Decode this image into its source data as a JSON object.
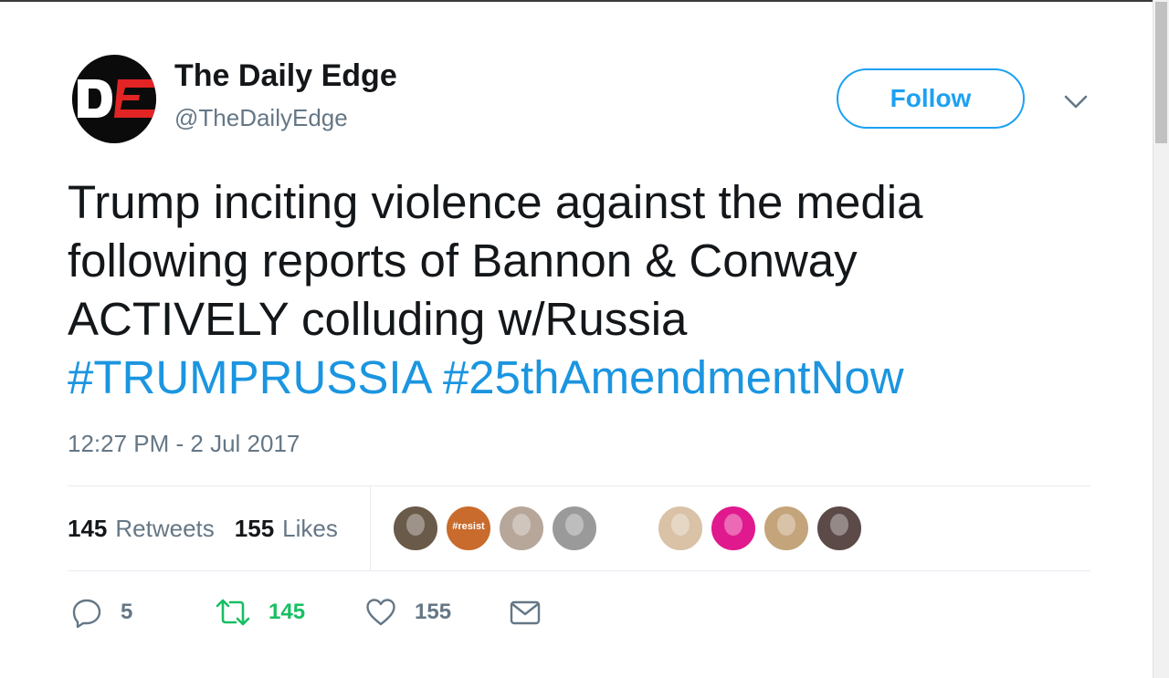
{
  "user": {
    "display_name": "The Daily Edge",
    "handle": "@TheDailyEdge",
    "avatar_icon": "the-daily-edge-logo"
  },
  "follow_button": {
    "label": "Follow"
  },
  "menu_icon": "chevron-down-icon",
  "tweet": {
    "lines": [
      "Trump inciting violence against the media",
      "following reports of Bannon & Conway",
      "ACTIVELY colluding w/Russia"
    ],
    "hashtags": [
      "#TRUMPRUSSIA",
      "#25thAmendmentNow"
    ],
    "timestamp": "12:27 PM - 2 Jul 2017"
  },
  "stats": {
    "retweets_count": "145",
    "retweets_label": "Retweets",
    "likes_count": "155",
    "likes_label": "Likes"
  },
  "likers": [
    {
      "name": "liker-avatar-1",
      "color": "#6a5a4a",
      "label": ""
    },
    {
      "name": "liker-avatar-2",
      "color": "#c86b2c",
      "label": "#resist"
    },
    {
      "name": "liker-avatar-3",
      "color": "#b6a79a",
      "label": ""
    },
    {
      "name": "liker-avatar-4",
      "color": "#9a9a9a",
      "label": ""
    },
    {
      "name": "liker-avatar-5",
      "color": "#ffffff",
      "label": ""
    },
    {
      "name": "liker-avatar-6",
      "color": "#d9c2a6",
      "label": ""
    },
    {
      "name": "liker-avatar-7",
      "color": "#e0198e",
      "label": ""
    },
    {
      "name": "liker-avatar-8",
      "color": "#c4a47a",
      "label": ""
    },
    {
      "name": "liker-avatar-9",
      "color": "#5b4a48",
      "label": ""
    }
  ],
  "actions": {
    "reply_count": "5",
    "retweet_count": "145",
    "like_count": "155",
    "retweet_color": "#17bf63",
    "muted_color": "#657786"
  },
  "colors": {
    "accent": "#1da1f2",
    "hashtag": "#1b95e0",
    "text": "#14171a",
    "secondary": "#657786"
  }
}
